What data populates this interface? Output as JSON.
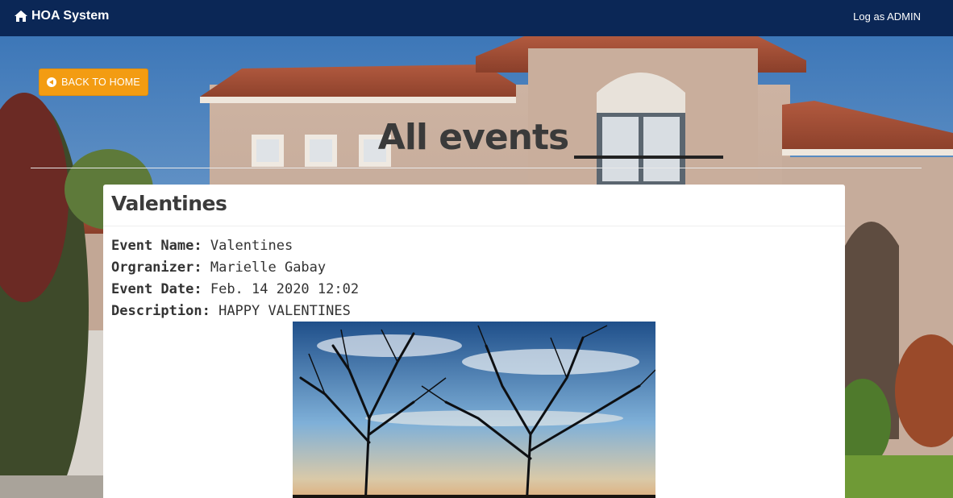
{
  "navbar": {
    "brand": "HOA System",
    "brand_icon": "home-icon",
    "login_link": "Log as ADMIN"
  },
  "back_button": {
    "label": "BACK TO HOME",
    "icon": "arrow-circle-left-icon",
    "color": "#f39c12"
  },
  "page_title": "All events",
  "event": {
    "title": "Valentines",
    "fields": [
      {
        "label": "Event Name:",
        "value": "Valentines"
      },
      {
        "label": "Orgranizer:",
        "value": "Marielle Gabay"
      },
      {
        "label": "Event Date:",
        "value": "Feb. 14 2020 12:02"
      },
      {
        "label": "Description:",
        "value": "HAPPY VALENTINES"
      }
    ]
  },
  "colors": {
    "navbar": "#0b2756",
    "accent": "#f39c12"
  }
}
